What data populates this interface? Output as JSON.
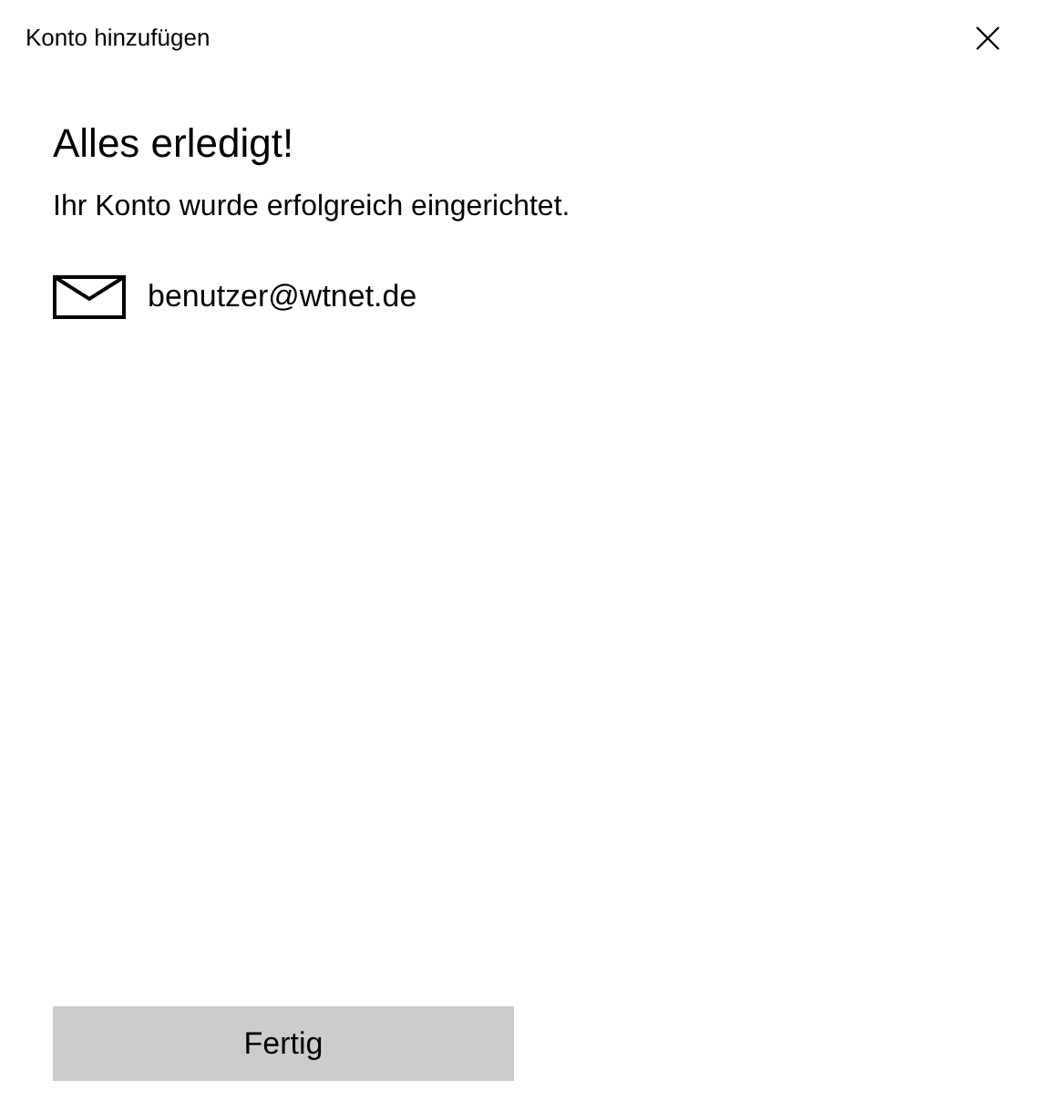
{
  "window": {
    "title": "Konto hinzufügen"
  },
  "heading": "Alles erledigt!",
  "message": "Ihr Konto wurde erfolgreich eingerichtet.",
  "account": {
    "email": "benutzer@wtnet.de"
  },
  "buttons": [
    "Fertig"
  ]
}
